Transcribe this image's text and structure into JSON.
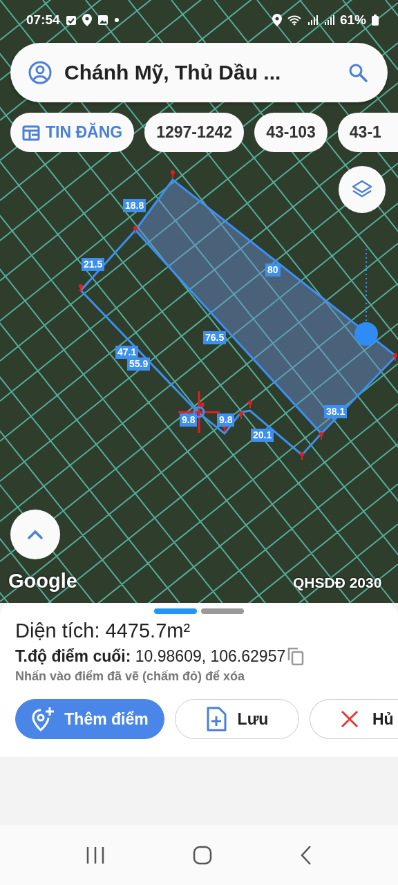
{
  "status_bar": {
    "time": "07:54",
    "battery": "61%"
  },
  "search": {
    "value": "Chánh Mỹ, Thủ Dầu ..."
  },
  "chips": [
    {
      "label": "TIN ĐĂNG",
      "kind": "feature"
    },
    {
      "label": "1297-1242",
      "kind": "parcel"
    },
    {
      "label": "43-103",
      "kind": "parcel"
    },
    {
      "label": "43-1",
      "kind": "parcel"
    }
  ],
  "map": {
    "edge_lengths": [
      "18.8",
      "21.5",
      "80",
      "76.5",
      "47.1",
      "55.9",
      "9.8",
      "9.8",
      "20.1",
      "38.1"
    ],
    "logo": "Google",
    "layer_name": "QHSDĐ 2030"
  },
  "sheet": {
    "pages": [
      {
        "selected": true
      },
      {
        "selected": false
      }
    ],
    "area": "Diện tích: **4475.7m²**",
    "coords": "**T.độ điểm cuối:** 10.98609, 106.62957",
    "hint": "Nhấn vào điểm đã vẽ (chấm đỏ) để xóa",
    "buttons": [
      {
        "label": "Thêm điểm",
        "kind": "add"
      },
      {
        "label": "Lưu",
        "kind": "save"
      },
      {
        "label": "Hủ",
        "kind": "cancel"
      }
    ]
  }
}
